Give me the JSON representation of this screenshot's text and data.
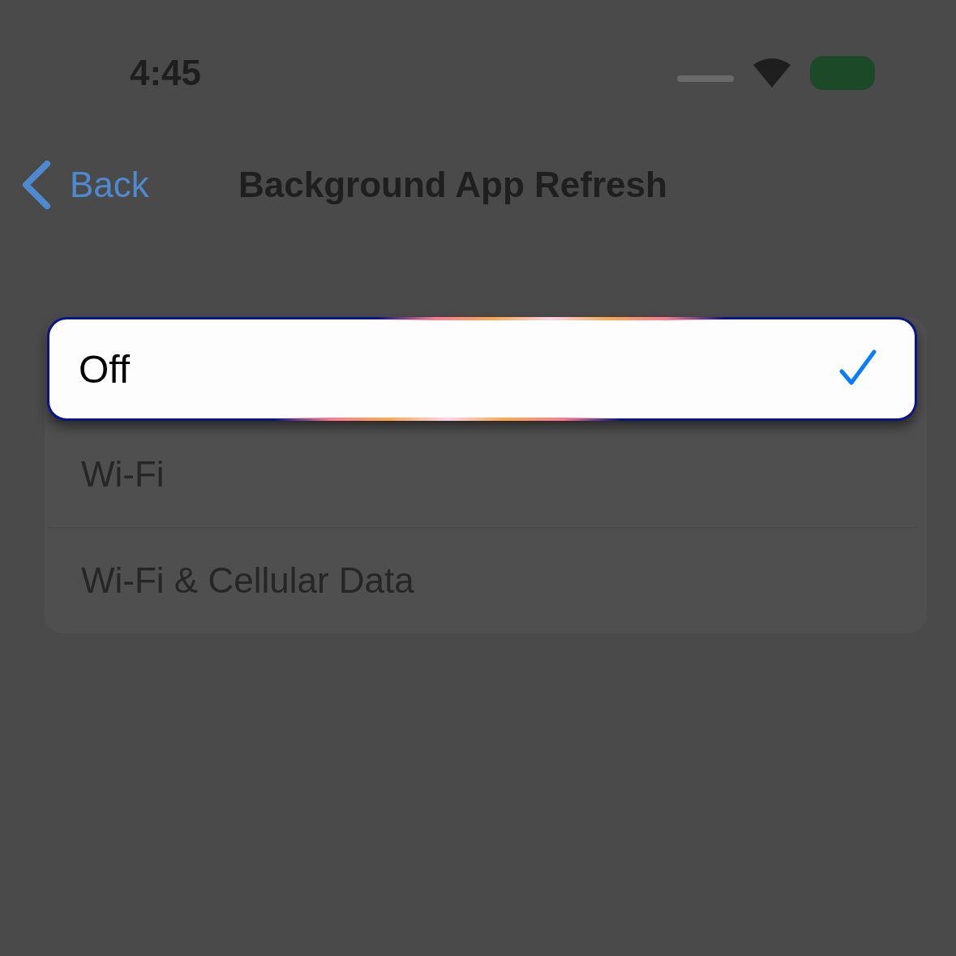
{
  "status_bar": {
    "time": "4:45"
  },
  "nav": {
    "back": "Back",
    "title": "Background App Refresh"
  },
  "options": [
    {
      "label": "Off",
      "selected": true
    },
    {
      "label": "Wi-Fi",
      "selected": false
    },
    {
      "label": "Wi-Fi & Cellular Data",
      "selected": false
    }
  ]
}
